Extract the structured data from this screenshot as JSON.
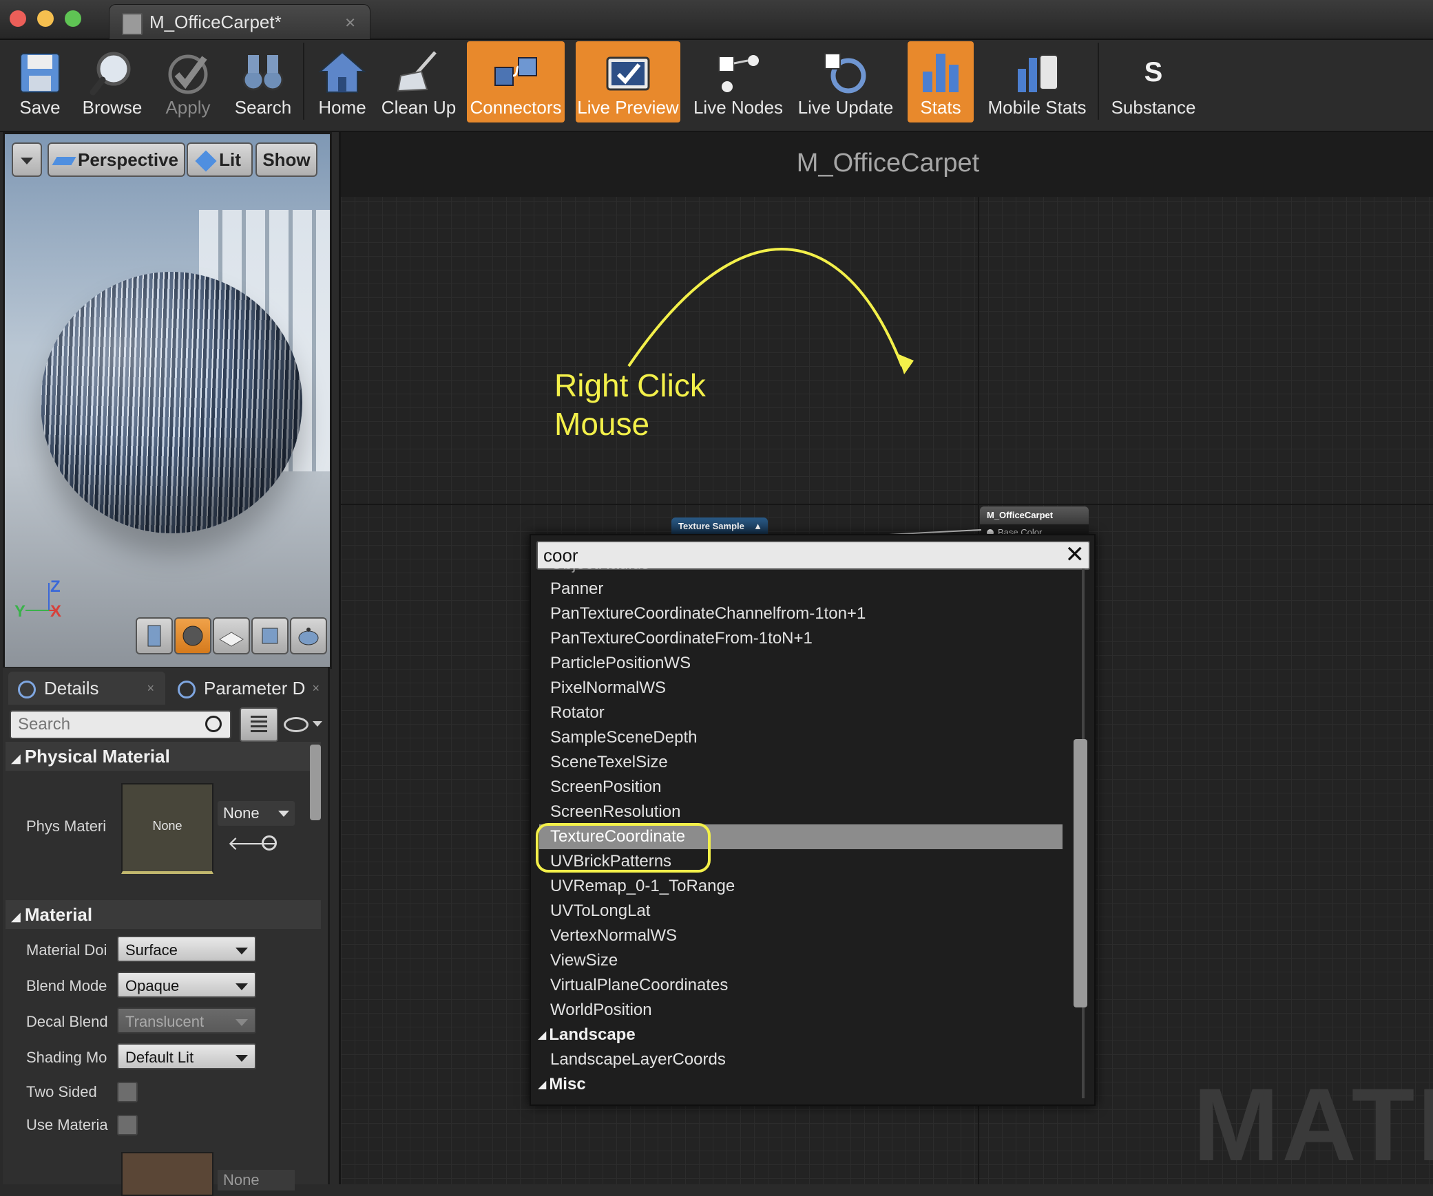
{
  "window": {
    "tab_title": "M_OfficeCarpet*",
    "traffic_lights": [
      "#ec5f59",
      "#f5bf4f",
      "#5fc454"
    ]
  },
  "toolbar": {
    "items": [
      {
        "label": "Save",
        "icon": "save-icon",
        "state": "normal"
      },
      {
        "label": "Browse",
        "icon": "magnifier-icon",
        "state": "normal"
      },
      {
        "label": "Apply",
        "icon": "checkmark-icon",
        "state": "disabled"
      },
      {
        "label": "Search",
        "icon": "binoculars-icon",
        "state": "normal"
      },
      {
        "label": "Home",
        "icon": "house-icon",
        "state": "normal"
      },
      {
        "label": "Clean Up",
        "icon": "broom-icon",
        "state": "normal"
      },
      {
        "label": "Connectors",
        "icon": "connector-icon",
        "state": "active"
      },
      {
        "label": "Live Preview",
        "icon": "tv-check-icon",
        "state": "active"
      },
      {
        "label": "Live Nodes",
        "icon": "nodes-icon",
        "state": "normal"
      },
      {
        "label": "Live Update",
        "icon": "refresh-icon",
        "state": "normal"
      },
      {
        "label": "Stats",
        "icon": "bar-chart-icon",
        "state": "active"
      },
      {
        "label": "Mobile Stats",
        "icon": "mobile-chart-icon",
        "state": "normal"
      },
      {
        "label": "Substance",
        "icon": "substance-icon",
        "state": "normal"
      }
    ]
  },
  "viewport": {
    "view_menu_icon": "dropdown-icon",
    "perspective_label": "Perspective",
    "lit_label": "Lit",
    "show_label": "Show",
    "axis_z": "Z",
    "axis_y": "Y",
    "axis_x": "X",
    "preview_shapes": [
      "cylinder-icon",
      "sphere-icon",
      "plane-icon",
      "cube-icon",
      "teapot-icon"
    ]
  },
  "details": {
    "tabs": [
      {
        "label": "Details",
        "close": "×"
      },
      {
        "label": "Parameter D",
        "close": "×"
      }
    ],
    "search_placeholder": "Search",
    "sections": {
      "physical_material": "Physical Material",
      "material": "Material"
    },
    "phys_material": {
      "label": "Phys Materi",
      "thumb_text": "None",
      "combo_value": "None"
    },
    "properties": [
      {
        "label": "Material Doi",
        "value": "Surface",
        "enabled": true
      },
      {
        "label": "Blend Mode",
        "value": "Opaque",
        "enabled": true
      },
      {
        "label": "Decal Blend",
        "value": "Translucent",
        "enabled": false
      },
      {
        "label": "Shading Mo",
        "value": "Default Lit",
        "enabled": true
      }
    ],
    "checkboxes": [
      {
        "label": "Two Sided",
        "checked": false
      },
      {
        "label": "Use Materia",
        "checked": false
      }
    ],
    "bottom_combo": "None"
  },
  "graph": {
    "title": "M_OfficeCarpet",
    "annotation_line1": "Right Click",
    "annotation_line2": "Mouse",
    "annotation_color": "#f3f04a",
    "texture_node": "Texture Sample",
    "result_node": "M_OfficeCarpet",
    "result_pin": "Base Color",
    "watermark": "MATI"
  },
  "menu": {
    "search_value": "coor",
    "clear_icon": "close-icon",
    "items": [
      {
        "text": "ObjectRadius",
        "type": "item"
      },
      {
        "text": "Panner",
        "type": "item"
      },
      {
        "text": "PanTextureCoordinateChannelfrom-1ton+1",
        "type": "item"
      },
      {
        "text": "PanTextureCoordinateFrom-1toN+1",
        "type": "item"
      },
      {
        "text": "ParticlePositionWS",
        "type": "item"
      },
      {
        "text": "PixelNormalWS",
        "type": "item"
      },
      {
        "text": "Rotator",
        "type": "item"
      },
      {
        "text": "SampleSceneDepth",
        "type": "item"
      },
      {
        "text": "SceneTexelSize",
        "type": "item"
      },
      {
        "text": "ScreenPosition",
        "type": "item"
      },
      {
        "text": "ScreenResolution",
        "type": "item"
      },
      {
        "text": "TextureCoordinate",
        "type": "selected"
      },
      {
        "text": "UVBrickPatterns",
        "type": "item"
      },
      {
        "text": "UVRemap_0-1_ToRange",
        "type": "item"
      },
      {
        "text": "UVToLongLat",
        "type": "item"
      },
      {
        "text": "VertexNormalWS",
        "type": "item"
      },
      {
        "text": "ViewSize",
        "type": "item"
      },
      {
        "text": "VirtualPlaneCoordinates",
        "type": "item"
      },
      {
        "text": "WorldPosition",
        "type": "item"
      },
      {
        "text": "Landscape",
        "type": "category"
      },
      {
        "text": "LandscapeLayerCoords",
        "type": "item"
      },
      {
        "text": "Misc",
        "type": "category"
      }
    ]
  }
}
